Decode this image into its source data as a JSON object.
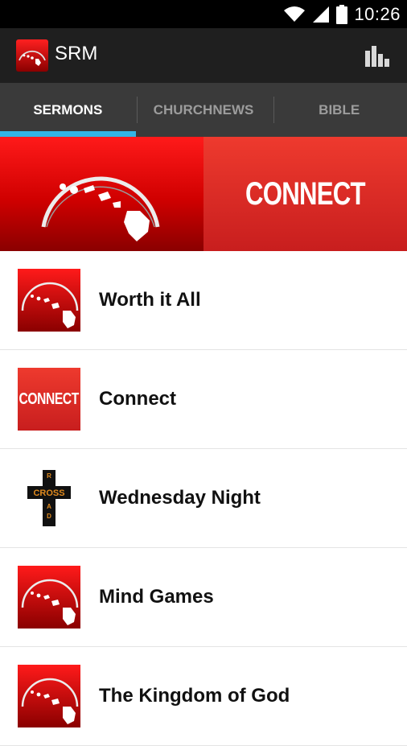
{
  "status_bar": {
    "time": "10:26"
  },
  "action_bar": {
    "title": "SRM"
  },
  "tabs": [
    {
      "label": "SERMONS",
      "active": true
    },
    {
      "label": "CHURCHNEWS",
      "active": false
    },
    {
      "label": "BIBLE",
      "active": false
    }
  ],
  "banner": {
    "right_text": "CONNECT"
  },
  "list": {
    "items": [
      {
        "label": "Worth it All",
        "thumb": "hawaii-logo"
      },
      {
        "label": "Connect",
        "thumb": "connect-logo",
        "thumb_text": "CONNECT"
      },
      {
        "label": "Wednesday Night",
        "thumb": "crossroad-logo",
        "thumb_cross": "CROSS",
        "thumb_road": "ROAD"
      },
      {
        "label": "Mind Games",
        "thumb": "hawaii-logo"
      },
      {
        "label": "The Kingdom of God",
        "thumb": "hawaii-logo"
      }
    ]
  },
  "colors": {
    "accent": "#33b5e5",
    "brand_red": "#e01010",
    "action_bar": "#1f1f1f",
    "tab_bar": "#3a3a3a"
  }
}
